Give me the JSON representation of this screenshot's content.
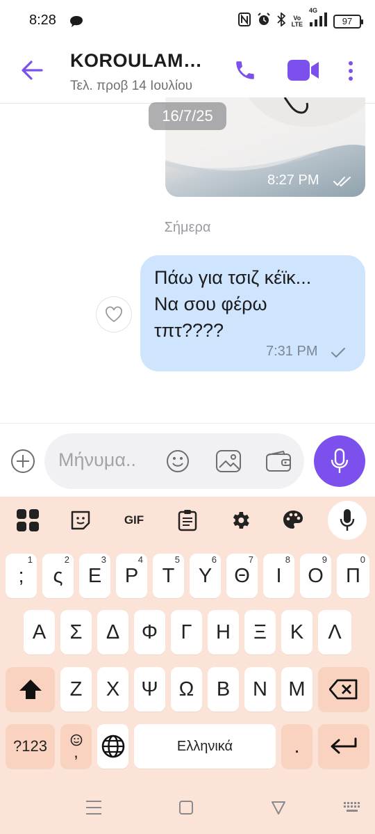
{
  "status_bar": {
    "time": "8:28",
    "battery": "97",
    "network": "4G"
  },
  "header": {
    "title": "KOROULAM…",
    "subtitle": "Τελ. προβ 14 Ιουλίου"
  },
  "chat": {
    "photo_message": {
      "date_badge": "16/7/25",
      "time": "8:27 PM"
    },
    "day_separator": "Σήμερα",
    "text_message": {
      "lines": [
        "Πάω για τσιζ κέϊκ...",
        "Να σου φέρω",
        "τπτ????"
      ],
      "time": "7:31 PM"
    }
  },
  "composer": {
    "placeholder": "Μήνυμα.."
  },
  "keyboard": {
    "toolbar": {
      "gif_label": "GIF"
    },
    "row1": [
      {
        "label": ";",
        "hint": "1"
      },
      {
        "label": "ς",
        "hint": "2"
      },
      {
        "label": "Ε",
        "hint": "3"
      },
      {
        "label": "Ρ",
        "hint": "4"
      },
      {
        "label": "Τ",
        "hint": "5"
      },
      {
        "label": "Υ",
        "hint": "6"
      },
      {
        "label": "Θ",
        "hint": "7"
      },
      {
        "label": "Ι",
        "hint": "8"
      },
      {
        "label": "Ο",
        "hint": "9"
      },
      {
        "label": "Π",
        "hint": "0"
      }
    ],
    "row2": [
      "Α",
      "Σ",
      "Δ",
      "Φ",
      "Γ",
      "Η",
      "Ξ",
      "Κ",
      "Λ"
    ],
    "row3": [
      "Ζ",
      "Χ",
      "Ψ",
      "Ω",
      "Β",
      "Ν",
      "Μ"
    ],
    "symbols_label": "?123",
    "emoji_comma_label": ",",
    "space_label": "Ελληνικά",
    "period_label": "."
  },
  "colors": {
    "accent": "#7b50ec",
    "bubble": "#cfe4fd",
    "keyboard_bg": "#fbe4d7"
  }
}
